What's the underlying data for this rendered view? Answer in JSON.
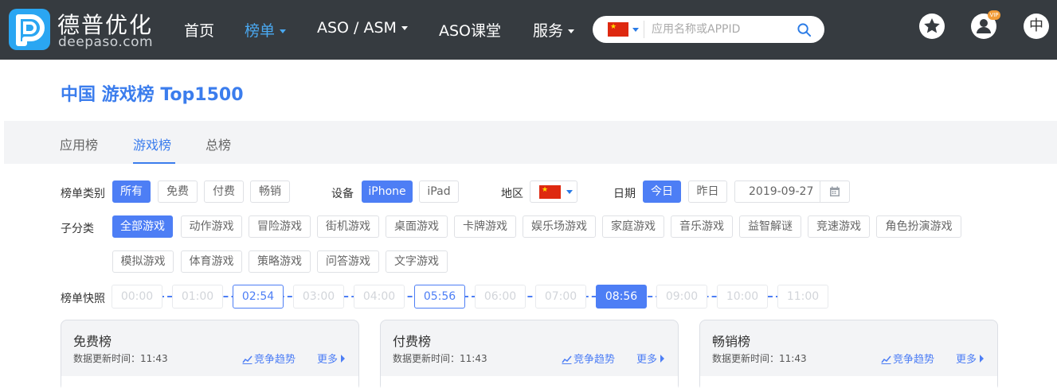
{
  "brand": {
    "name_cn": "德普优化",
    "domain": "deepaso.com"
  },
  "nav": {
    "items": [
      {
        "label": "首页",
        "dropdown": false,
        "active": false
      },
      {
        "label": "榜单",
        "dropdown": true,
        "active": true
      },
      {
        "label": "ASO / ASM",
        "dropdown": true,
        "active": false
      },
      {
        "label": "ASO课堂",
        "dropdown": false,
        "active": false
      },
      {
        "label": "服务",
        "dropdown": true,
        "active": false
      }
    ],
    "search_placeholder": "应用名称或APPID",
    "vip_badge": "VIP",
    "lang": "中"
  },
  "page": {
    "title": "中国 游戏榜 Top1500"
  },
  "tabs": [
    {
      "label": "应用榜",
      "active": false
    },
    {
      "label": "游戏榜",
      "active": true
    },
    {
      "label": "总榜",
      "active": false
    }
  ],
  "filters": {
    "list_type_label": "榜单类别",
    "list_types": [
      {
        "label": "所有",
        "selected": true
      },
      {
        "label": "免费",
        "selected": false
      },
      {
        "label": "付费",
        "selected": false
      },
      {
        "label": "畅销",
        "selected": false
      }
    ],
    "device_label": "设备",
    "devices": [
      {
        "label": "iPhone",
        "selected": true
      },
      {
        "label": "iPad",
        "selected": false
      }
    ],
    "region_label": "地区",
    "date_label": "日期",
    "dates": [
      {
        "label": "今日",
        "selected": true
      },
      {
        "label": "昨日",
        "selected": false
      }
    ],
    "date_value": "2019-09-27",
    "subcategory_label": "子分类",
    "subcategories": [
      {
        "label": "全部游戏",
        "selected": true
      },
      {
        "label": "动作游戏"
      },
      {
        "label": "冒险游戏"
      },
      {
        "label": "街机游戏"
      },
      {
        "label": "桌面游戏"
      },
      {
        "label": "卡牌游戏"
      },
      {
        "label": "娱乐场游戏"
      },
      {
        "label": "家庭游戏"
      },
      {
        "label": "音乐游戏"
      },
      {
        "label": "益智解谜"
      },
      {
        "label": "竞速游戏"
      },
      {
        "label": "角色扮演游戏"
      },
      {
        "label": "模拟游戏"
      },
      {
        "label": "体育游戏"
      },
      {
        "label": "策略游戏"
      },
      {
        "label": "问答游戏"
      },
      {
        "label": "文字游戏"
      }
    ],
    "snapshot_label": "榜单快照",
    "snapshots": [
      {
        "time": "00:00",
        "state": "disabled"
      },
      {
        "time": "01:00",
        "state": "disabled"
      },
      {
        "time": "02:54",
        "state": "available"
      },
      {
        "time": "03:00",
        "state": "disabled"
      },
      {
        "time": "04:00",
        "state": "disabled"
      },
      {
        "time": "05:56",
        "state": "available"
      },
      {
        "time": "06:00",
        "state": "disabled"
      },
      {
        "time": "07:00",
        "state": "disabled"
      },
      {
        "time": "08:56",
        "state": "current"
      },
      {
        "time": "09:00",
        "state": "disabled"
      },
      {
        "time": "10:00",
        "state": "disabled"
      },
      {
        "time": "11:00",
        "state": "disabled"
      }
    ]
  },
  "cards": [
    {
      "title": "免费榜",
      "update_text": "数据更新时间：11:43",
      "trend_label": "竞争趋势",
      "more_label": "更多"
    },
    {
      "title": "付费榜",
      "update_text": "数据更新时间：11:43",
      "trend_label": "竞争趋势",
      "more_label": "更多"
    },
    {
      "title": "畅销榜",
      "update_text": "数据更新时间：11:43",
      "trend_label": "竞争趋势",
      "more_label": "更多"
    }
  ],
  "colors": {
    "accent": "#4d7ef5",
    "topbar": "#363b40",
    "title": "#3b7ded",
    "flag_red": "#de2910",
    "vip": "#f29c38"
  }
}
